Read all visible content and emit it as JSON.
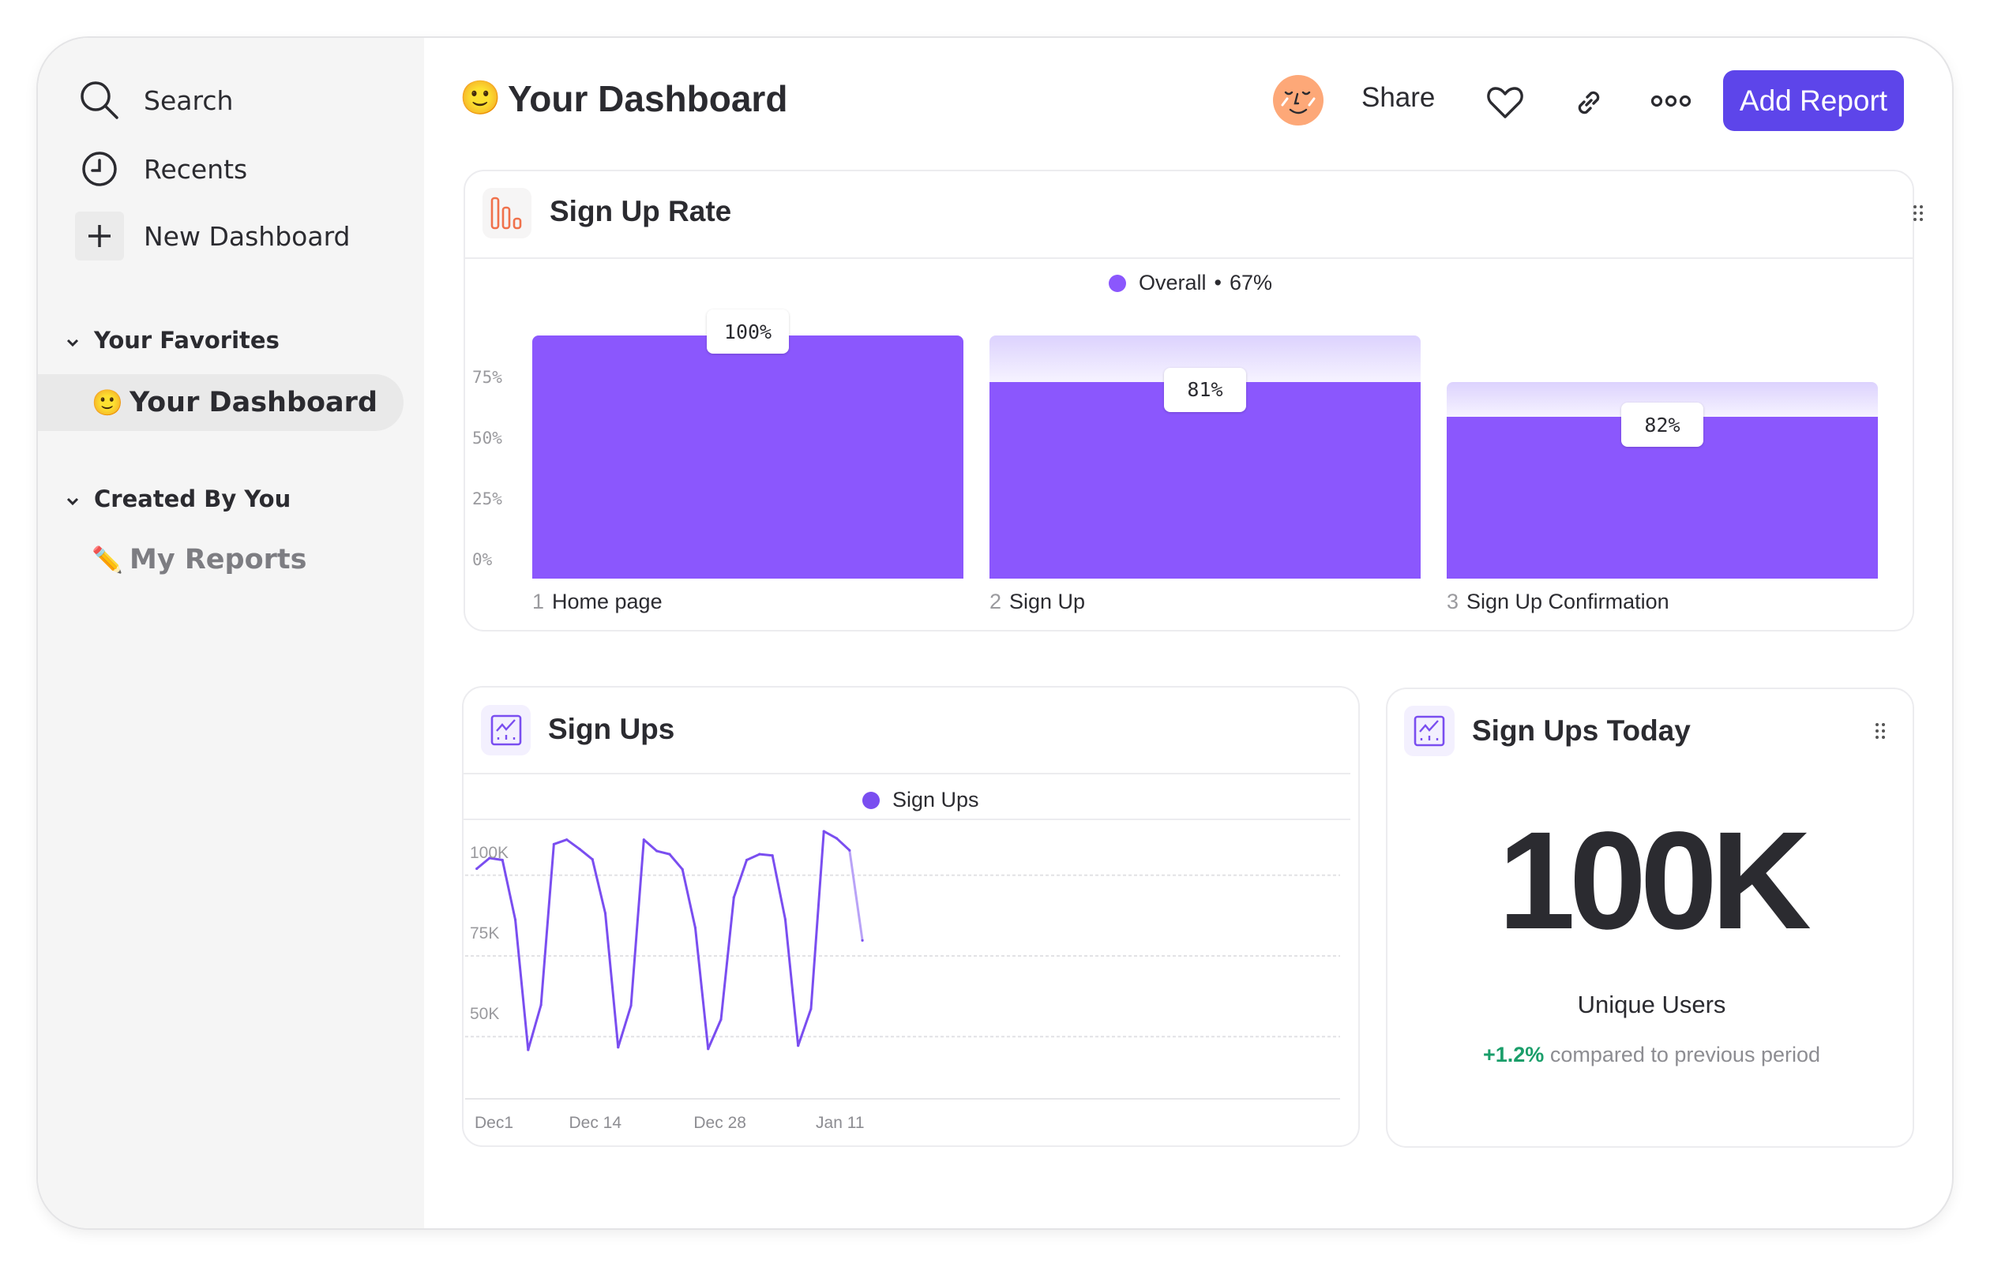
{
  "sidebar": {
    "search": "Search",
    "recents": "Recents",
    "new_dashboard": "New Dashboard",
    "favorites_header": "Your Favorites",
    "favorites": [
      {
        "emoji": "🙂",
        "label": "Your Dashboard",
        "active": true
      }
    ],
    "created_header": "Created By You",
    "created": [
      {
        "emoji": "✏️",
        "label": "My Reports"
      }
    ]
  },
  "header": {
    "emoji": "🙂",
    "title": "Your Dashboard",
    "share": "Share",
    "add_report": "Add Report",
    "icons": [
      "avatar",
      "heart-icon",
      "link-icon",
      "more-icon"
    ]
  },
  "colors": {
    "accent": "#5d45ea",
    "bar": "#8b57fd",
    "bar_light": "#e3dbfe",
    "line": "#7a4ef0",
    "positive": "#1a9e6a",
    "funnel_icon": "#f0714b"
  },
  "cards": {
    "signup_rate": {
      "title": "Sign Up Rate"
    },
    "signups": {
      "title": "Sign Ups"
    },
    "signups_today": {
      "title": "Sign Ups Today",
      "value": "100K",
      "caption": "Unique Users",
      "delta": "+1.2%",
      "delta_text": "compared to previous period"
    }
  },
  "chart_data": [
    {
      "type": "bar",
      "title": "Sign Up Rate",
      "legend": {
        "name": "Overall",
        "value": "67%",
        "placement": "top-center"
      },
      "categories": [
        {
          "step": "1",
          "label": "Home page"
        },
        {
          "step": "2",
          "label": "Sign Up"
        },
        {
          "step": "3",
          "label": "Sign Up Confirmation"
        }
      ],
      "step_conversion": [
        100,
        81,
        82
      ],
      "value_labels": [
        "100%",
        "81%",
        "82%"
      ],
      "yticks": [
        {
          "v": 0,
          "label": "0%"
        },
        {
          "v": 25,
          "label": "25%"
        },
        {
          "v": 50,
          "label": "50%"
        },
        {
          "v": 75,
          "label": "75%"
        }
      ],
      "ylim": [
        0,
        100
      ],
      "grid": false
    },
    {
      "type": "line",
      "title": "Sign Ups",
      "series": [
        {
          "name": "Sign Ups",
          "values": [
            102,
            105.3,
            104.7,
            86.2,
            45.9,
            59.8,
            109.6,
            111,
            108.1,
            104.9,
            88.2,
            46.7,
            59.6,
            111,
            107.5,
            106.5,
            101.8,
            83.7,
            46.2,
            55.3,
            93.1,
            104.7,
            106.5,
            106.1,
            86.3,
            47.2,
            58.6,
            113.6,
            111.4,
            107.7,
            79.8
          ]
        }
      ],
      "units": "K",
      "last_point_incomplete": true,
      "yticks": [
        {
          "v": 50,
          "label": "50K"
        },
        {
          "v": 75,
          "label": "75K"
        },
        {
          "v": 100,
          "label": "100K"
        }
      ],
      "xticks": [
        {
          "i": 0,
          "label": "Dec1"
        },
        {
          "i": 9.2,
          "label": "Dec 14"
        },
        {
          "i": 18.9,
          "label": "Dec 28"
        },
        {
          "i": 28.4,
          "label": "Jan 11"
        }
      ],
      "grid": true,
      "legend_placement": "top-center"
    }
  ]
}
